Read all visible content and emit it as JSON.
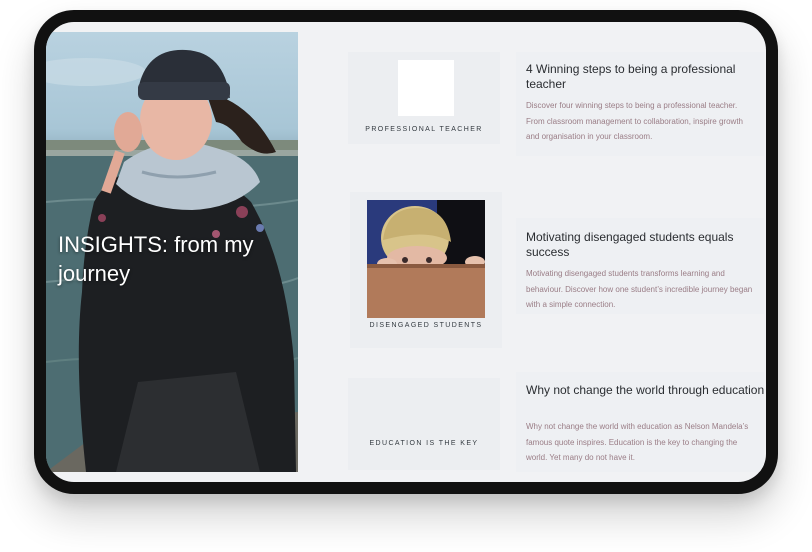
{
  "hero": {
    "title": "INSIGHTS: from my journey"
  },
  "articles": [
    {
      "thumb_label": "PROFESSIONAL TEACHER",
      "title": "4 Winning steps to being a professional teacher",
      "description": "Discover four winning steps to being a professional teacher. From classroom management to collaboration, inspire growth and organisation in your classroom."
    },
    {
      "thumb_label": "DISENGAGED STUDENTS",
      "title": "Motivating disengaged students equals success",
      "description": "Motivating disengaged students transforms learning and behaviour. Discover how one student’s incredible journey began with a simple connection."
    },
    {
      "thumb_label": "EDUCATION IS THE KEY",
      "title": "Why not change the world through education",
      "description": "Why not change the world with education as Nelson Mandela’s famous quote inspires. Education is the key to changing the world. Yet many do not have it."
    }
  ]
}
